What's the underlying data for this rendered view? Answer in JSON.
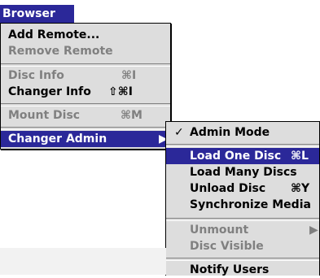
{
  "menu_title": "Browser",
  "main_menu": {
    "items": [
      {
        "label": "Add Remote...",
        "shortcut": "",
        "enabled": true
      },
      {
        "label": "Remove Remote",
        "shortcut": "",
        "enabled": false
      },
      {
        "label": "Disc Info",
        "shortcut": "⌘I",
        "enabled": false
      },
      {
        "label": "Changer Info",
        "shortcut": "⇧⌘I",
        "enabled": true
      },
      {
        "label": "Mount Disc",
        "shortcut": "⌘M",
        "enabled": false
      },
      {
        "label": "Changer Admin",
        "shortcut": "",
        "enabled": true,
        "selected": true,
        "submenu_arrow": "▶"
      }
    ]
  },
  "sub_menu": {
    "items": [
      {
        "label": "Admin Mode",
        "check": "✓",
        "shortcut": "",
        "enabled": true
      },
      {
        "label": "Load One Disc",
        "shortcut": "⌘L",
        "enabled": true,
        "selected": true
      },
      {
        "label": "Load Many Discs",
        "shortcut": "",
        "enabled": true
      },
      {
        "label": "Unload Disc",
        "shortcut": "⌘Y",
        "enabled": true
      },
      {
        "label": "Synchronize Media",
        "shortcut": "",
        "enabled": true
      },
      {
        "label": "Unmount",
        "shortcut": "",
        "enabled": false,
        "submenu_arrow": "▶"
      },
      {
        "label": "Disc Visible",
        "shortcut": "",
        "enabled": false
      },
      {
        "label": "Notify Users",
        "shortcut": "",
        "enabled": true
      }
    ]
  },
  "colors": {
    "menu_background": "#dddddd",
    "highlight": "#2b2899",
    "disabled_text": "#808080"
  }
}
